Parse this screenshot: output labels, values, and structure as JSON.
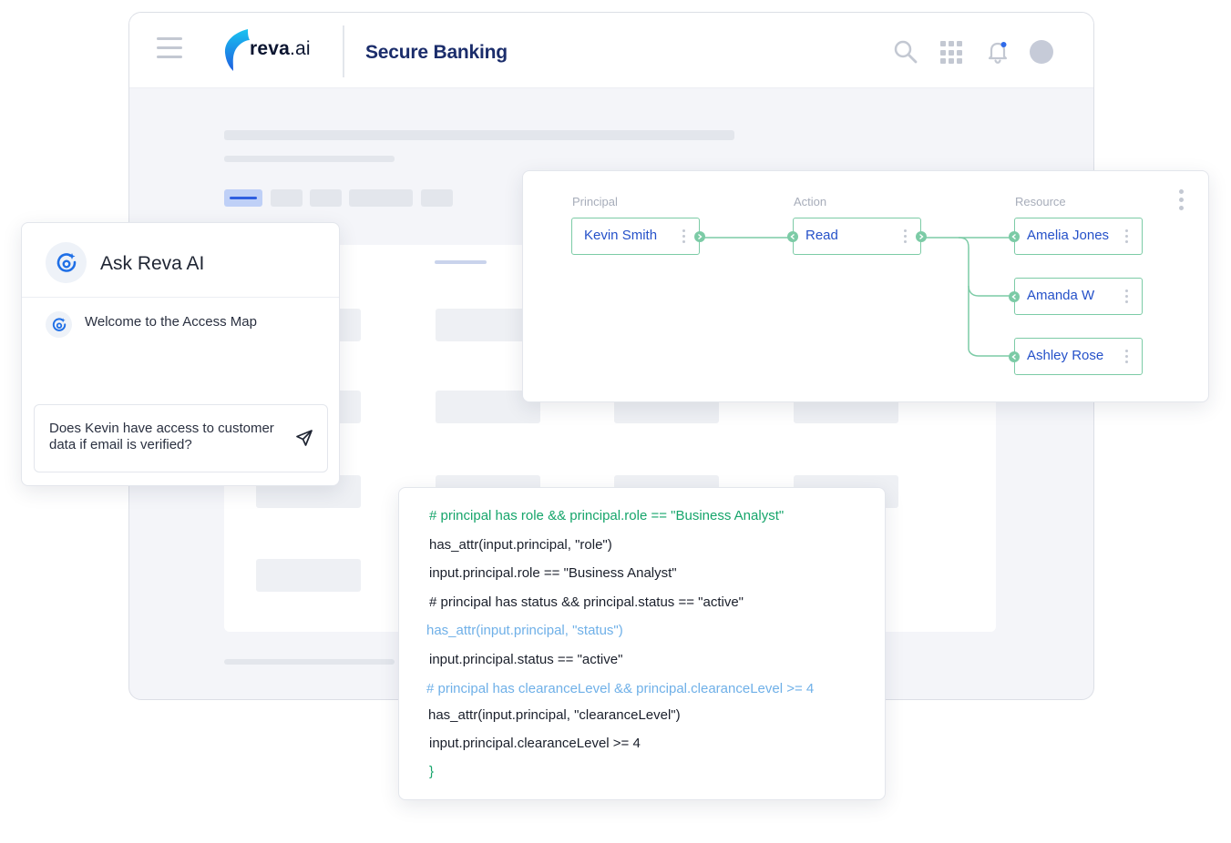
{
  "app": {
    "logo_name": "reva",
    "logo_suffix": ".ai",
    "title": "Secure Banking"
  },
  "topbar_icons": [
    "menu-icon",
    "search-icon",
    "apps-grid-icon",
    "bell-icon",
    "avatar"
  ],
  "chat": {
    "title": "Ask Reva AI",
    "welcome": "Welcome to the Access Map",
    "input_value": "Does Kevin have access to customer data if email is verified?"
  },
  "access_map": {
    "columns": {
      "principal": "Principal",
      "action": "Action",
      "resource": "Resource"
    },
    "principal": "Kevin Smith",
    "action": "Read",
    "resources": [
      "Amelia Jones",
      "Amanda W",
      "Ashley Rose"
    ]
  },
  "code_lines": [
    "# principal has role && principal.role == \"Business Analyst\"",
    "has_attr(input.principal, \"role\")",
    "input.principal.role == \"Business Analyst\"",
    "# principal has status && principal.status == \"active\"",
    "has_attr(input.principal, \"status\")",
    "input.principal.status == \"active\"",
    "# principal has clearanceLevel && principal.clearanceLevel >= 4",
    "has_attr(input.principal, \"clearanceLevel\")",
    "input.principal.clearanceLevel >= 4",
    "}"
  ],
  "colors": {
    "brand_navy": "#1b2d6b",
    "link_blue": "#2551c9",
    "node_green": "#7ccba6",
    "code_green": "#16a56b",
    "code_light_blue": "#6fb0e8"
  }
}
